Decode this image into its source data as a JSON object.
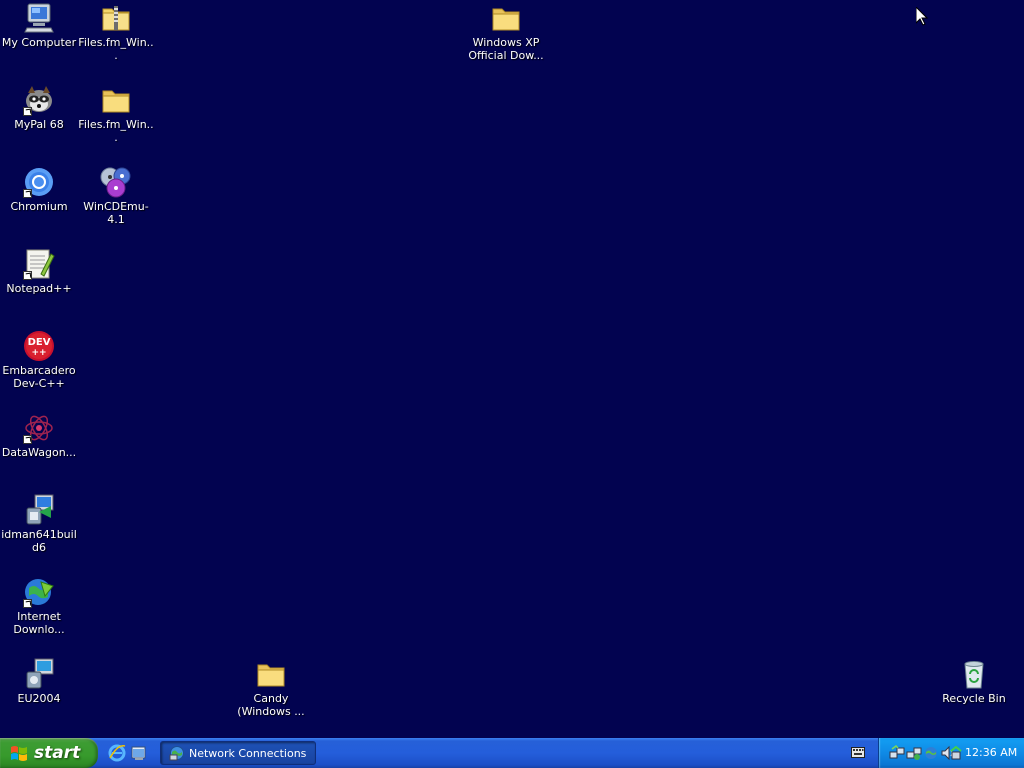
{
  "desktop": {
    "icons": [
      {
        "id": "my-computer",
        "label": "My Computer",
        "label2": ""
      },
      {
        "id": "files-fm-zip",
        "label": "Files.fm_Win...",
        "label2": ""
      },
      {
        "id": "winxp-folder",
        "label": "Windows XP",
        "label2": "Official Dow..."
      },
      {
        "id": "mypal",
        "label": "MyPal 68",
        "label2": ""
      },
      {
        "id": "files-fm-folder",
        "label": "Files.fm_Win...",
        "label2": ""
      },
      {
        "id": "chromium",
        "label": "Chromium",
        "label2": ""
      },
      {
        "id": "wincdemu",
        "label": "WinCDEmu-4.1",
        "label2": ""
      },
      {
        "id": "notepadpp",
        "label": "Notepad++",
        "label2": ""
      },
      {
        "id": "devcpp",
        "label": "Embarcadero",
        "label2": "Dev-C++"
      },
      {
        "id": "datawagon",
        "label": "DataWagon...",
        "label2": ""
      },
      {
        "id": "idman",
        "label": "idman641build6",
        "label2": ""
      },
      {
        "id": "idm",
        "label": "Internet",
        "label2": "Downlo..."
      },
      {
        "id": "eu2004",
        "label": "EU2004",
        "label2": ""
      },
      {
        "id": "candy",
        "label": "Candy",
        "label2": "(Windows ..."
      },
      {
        "id": "recycle-bin",
        "label": "Recycle Bin",
        "label2": ""
      }
    ]
  },
  "taskbar": {
    "start_label": "start",
    "task_button_label": "Network Connections",
    "clock": "12:36 AM"
  },
  "icons": {
    "start": "windows-flag-icon",
    "quick_launch": [
      "internet-explorer-icon",
      "show-desktop-icon"
    ],
    "task": "network-connections-icon",
    "language_bar": "keyboard-icon",
    "tray": [
      "network-tray-icon",
      "network-tray-icon",
      "network-globe-icon",
      "volume-icon",
      "safely-remove-icon"
    ]
  },
  "colors": {
    "desktop_background": "#020350",
    "taskbar_blue": "#245edb",
    "start_green": "#379a2c",
    "tray_blue": "#0f8ae6"
  }
}
